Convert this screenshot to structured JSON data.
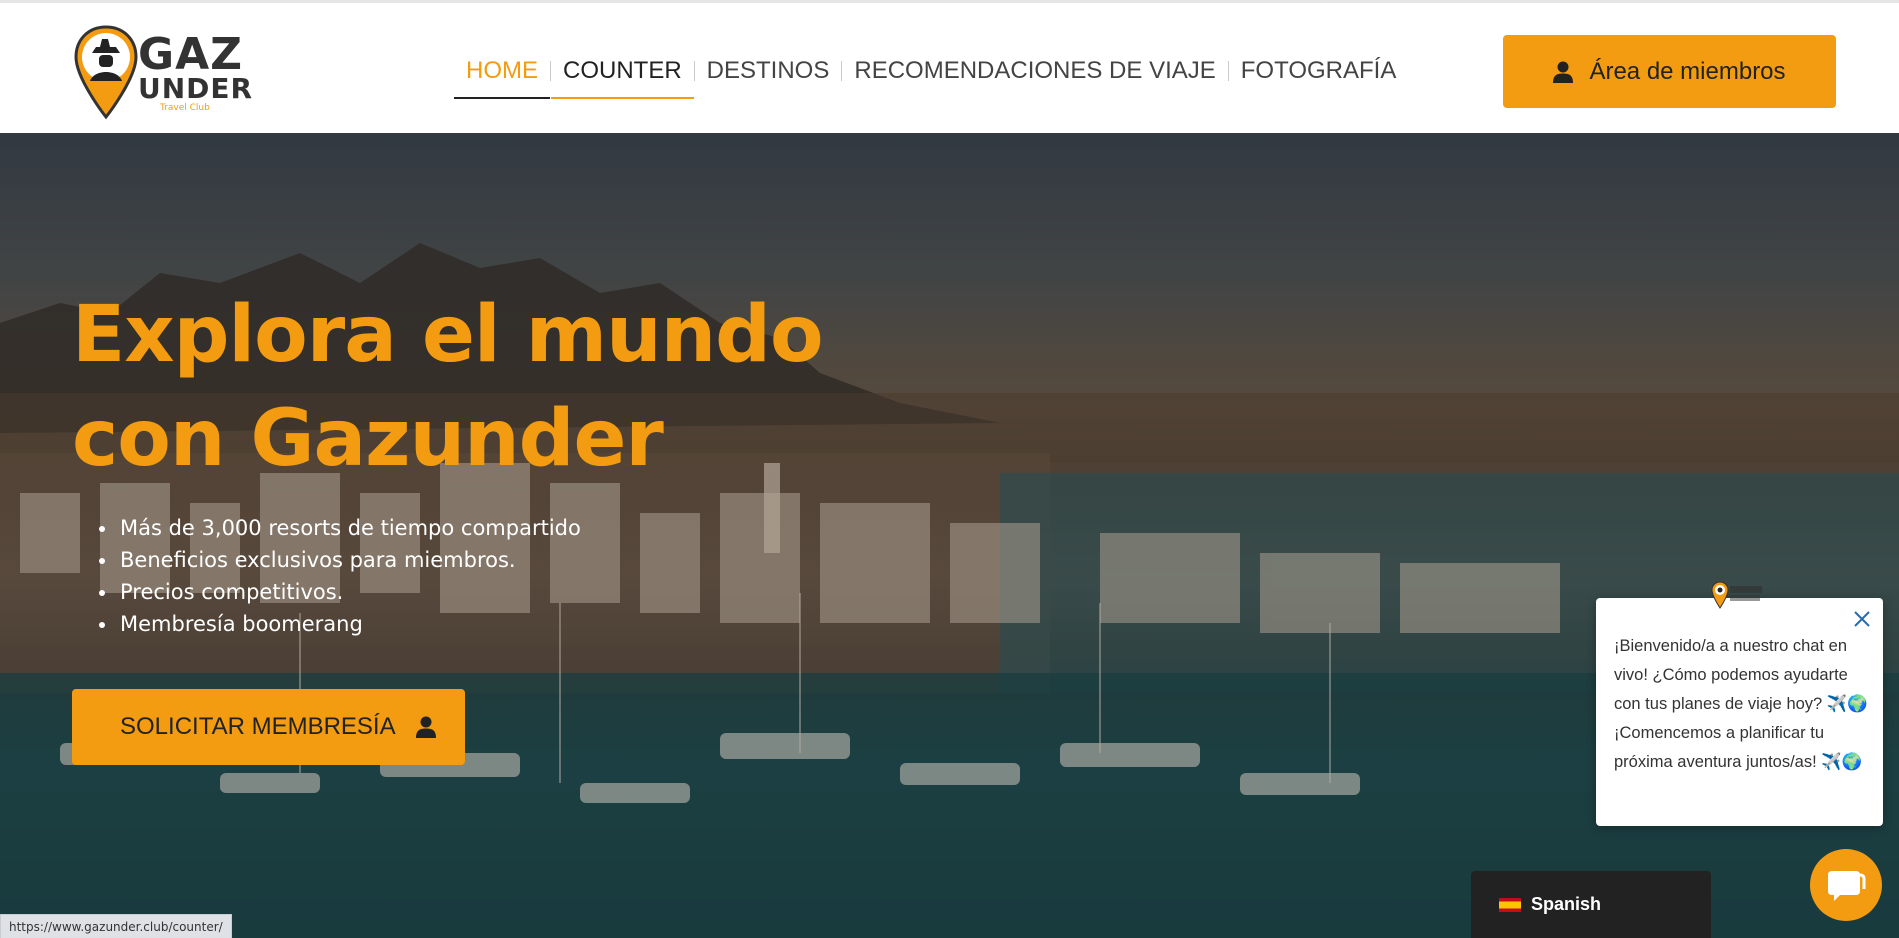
{
  "brand": {
    "logo_main": "GAZ",
    "logo_second": "UNDER",
    "logo_tagline": "Travel Club"
  },
  "nav": {
    "items": [
      {
        "label": "HOME",
        "state": "active"
      },
      {
        "label": "COUNTER",
        "state": "hover"
      },
      {
        "label": "DESTINOS",
        "state": "normal"
      },
      {
        "label": "RECOMENDACIONES DE VIAJE",
        "state": "normal"
      },
      {
        "label": "FOTOGRAFÍA",
        "state": "normal"
      }
    ]
  },
  "header": {
    "members_button_label": "Área de miembros"
  },
  "hero": {
    "title_line1": "Explora el mundo",
    "title_line2": "con Gazunder",
    "bullets": [
      "Más de 3,000 resorts de tiempo compartido",
      "Beneficios exclusivos para miembros.",
      "Precios competitivos.",
      "Membresía boomerang"
    ],
    "cta_label": "SOLICITAR MEMBRESÍA"
  },
  "chat": {
    "welcome_text": "¡Bienvenido/a a nuestro chat en vivo! ¿Cómo podemos ayudarte con tus planes de viaje hoy? ✈️🌍¡Comencemos a planificar tu próxima aventura juntos/as! ✈️🌍"
  },
  "language": {
    "label": "Spanish"
  },
  "status_bar": {
    "url": "https://www.gazunder.club/counter/"
  },
  "colors": {
    "accent": "#f39c12",
    "dark": "#222222"
  },
  "icons": {
    "members": "user-icon",
    "cta": "user-icon",
    "chat": "chat-bubble-icon",
    "close": "close-icon",
    "flag": "spain-flag-icon"
  }
}
